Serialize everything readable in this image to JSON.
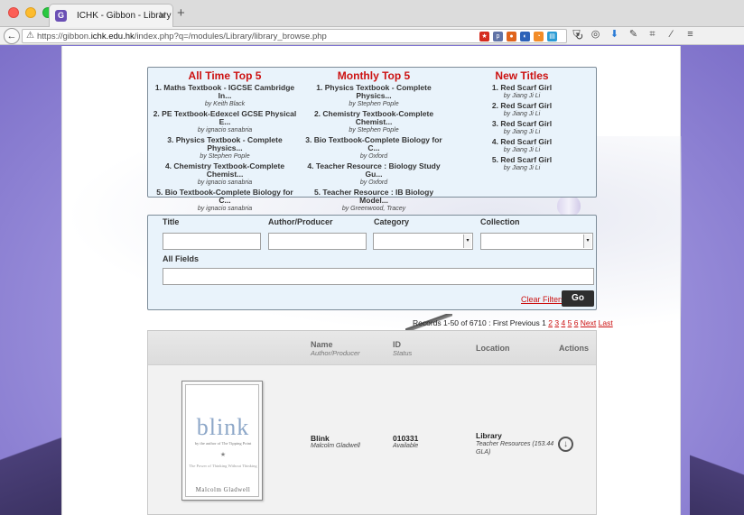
{
  "browser": {
    "tab_title": "ICHK - Gibbon - Library",
    "tab_favicon": "G",
    "url_prefix": "https://gibbon.",
    "url_domain": "ichk.edu.hk",
    "url_path": "/index.php?q=/modules/Library/library_browse.php"
  },
  "top_lists": {
    "all_time": {
      "title": "All Time Top 5",
      "items": [
        {
          "title": "1. Maths Textbook - IGCSE Cambridge In...",
          "by": "by Keith Black"
        },
        {
          "title": "2. PE Textbook-Edexcel GCSE Physical E...",
          "by": "by ignacio sanabria"
        },
        {
          "title": "3. Physics Textbook - Complete Physics...",
          "by": "by Stephen Pople"
        },
        {
          "title": "4. Chemistry Textbook-Complete Chemist...",
          "by": "by ignacio sanabria"
        },
        {
          "title": "5. Bio Textbook-Complete Biology for C...",
          "by": "by ignacio sanabria"
        }
      ]
    },
    "monthly": {
      "title": "Monthly Top 5",
      "items": [
        {
          "title": "1. Physics Textbook - Complete Physics...",
          "by": "by Stephen Pople"
        },
        {
          "title": "2. Chemistry Textbook-Complete Chemist...",
          "by": "by Stephen Pople"
        },
        {
          "title": "3. Bio Textbook-Complete Biology for C...",
          "by": "by Oxford"
        },
        {
          "title": "4. Teacher Resource : Biology Study Gu...",
          "by": "by Oxford"
        },
        {
          "title": "5. Teacher Resource : IB Biology Model...",
          "by": "by Greenwood, Tracey"
        }
      ]
    },
    "new_titles": {
      "title": "New Titles",
      "items": [
        {
          "title": "1. Red Scarf Girl",
          "by": "by Jiang Ji Li"
        },
        {
          "title": "2. Red Scarf Girl",
          "by": "by Jiang Ji Li"
        },
        {
          "title": "3. Red Scarf Girl",
          "by": "by Jiang Ji Li"
        },
        {
          "title": "4. Red Scarf Girl",
          "by": "by Jiang Ji Li"
        },
        {
          "title": "5. Red Scarf Girl",
          "by": "by Jiang Ji Li"
        }
      ]
    }
  },
  "filters": {
    "title_label": "Title",
    "author_label": "Author/Producer",
    "category_label": "Category",
    "collection_label": "Collection",
    "all_fields_label": "All Fields",
    "clear_label": "Clear Filters",
    "go_label": "Go"
  },
  "pager": {
    "summary": "Records 1-50 of 6710 : First Previous 1",
    "pages": [
      "2",
      "3",
      "4",
      "5",
      "6"
    ],
    "next": "Next",
    "last": "Last"
  },
  "table": {
    "headers": {
      "name": "Name",
      "name_sub": "Author/Producer",
      "id": "ID",
      "id_sub": "Status",
      "location": "Location",
      "actions": "Actions"
    },
    "row": {
      "cover_title": "blink",
      "cover_subtitle": "by the author of The Tipping Point",
      "cover_tagline": "The Power of Thinking Without Thinking",
      "cover_author": "Malcolm Gladwell",
      "name": "Blink",
      "author": "Malcolm Gladwell",
      "id": "010331",
      "status": "Available",
      "location": "Library",
      "location_sub": "Teacher Resources (153.44 GLA)"
    }
  },
  "colors": {
    "accent_red": "#cc1111",
    "panel_bg": "#e9f3fb",
    "button_dark": "#2e2e2e"
  }
}
